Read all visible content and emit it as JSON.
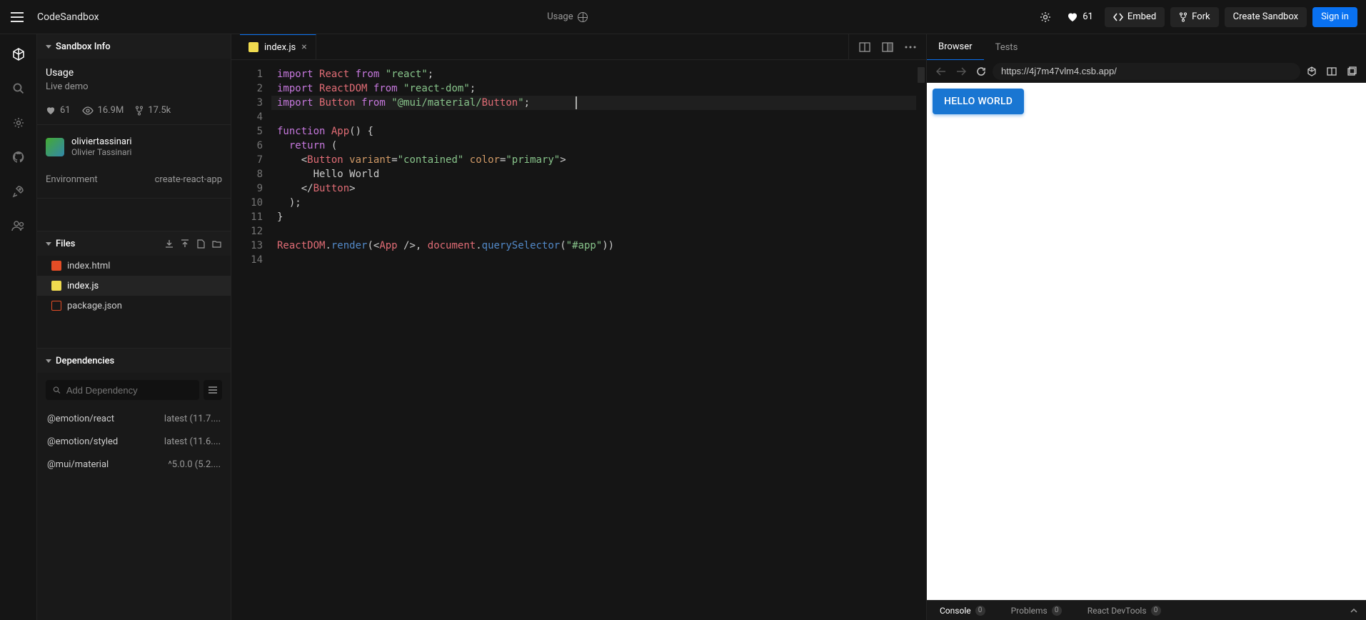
{
  "header": {
    "brand": "CodeSandbox",
    "center_title": "Usage",
    "likes": "61",
    "embed": "Embed",
    "fork": "Fork",
    "create": "Create Sandbox",
    "signin": "Sign in"
  },
  "sidebar": {
    "info_header": "Sandbox Info",
    "title": "Usage",
    "subtitle": "Live demo",
    "stats": {
      "likes": "61",
      "views": "16.9M",
      "forks": "17.5k"
    },
    "author": {
      "username": "oliviertassinari",
      "name": "Olivier Tassinari"
    },
    "env": {
      "label": "Environment",
      "value": "create-react-app"
    },
    "files_header": "Files",
    "files": [
      {
        "name": "index.html",
        "type": "html"
      },
      {
        "name": "index.js",
        "type": "js"
      },
      {
        "name": "package.json",
        "type": "json"
      }
    ],
    "deps_header": "Dependencies",
    "deps_placeholder": "Add Dependency",
    "deps": [
      {
        "name": "@emotion/react",
        "version": "latest (11.7...."
      },
      {
        "name": "@emotion/styled",
        "version": "latest (11.6...."
      },
      {
        "name": "@mui/material",
        "version": "^5.0.0 (5.2...."
      }
    ]
  },
  "editor": {
    "tab_name": "index.js",
    "lines": [
      "import React from \"react\";",
      "import ReactDOM from \"react-dom\";",
      "import Button from \"@mui/material/Button\";",
      "",
      "function App() {",
      "  return (",
      "    <Button variant=\"contained\" color=\"primary\">",
      "      Hello World",
      "    </Button>",
      "  );",
      "}",
      "",
      "ReactDOM.render(<App />, document.querySelector(\"#app\"))",
      ""
    ]
  },
  "preview": {
    "tabs": {
      "browser": "Browser",
      "tests": "Tests"
    },
    "url": "https://4j7m47vlm4.csb.app/",
    "button_text": "HELLO WORLD"
  },
  "console": {
    "tabs": [
      {
        "label": "Console",
        "count": "0"
      },
      {
        "label": "Problems",
        "count": "0"
      },
      {
        "label": "React DevTools",
        "count": "0"
      }
    ]
  }
}
